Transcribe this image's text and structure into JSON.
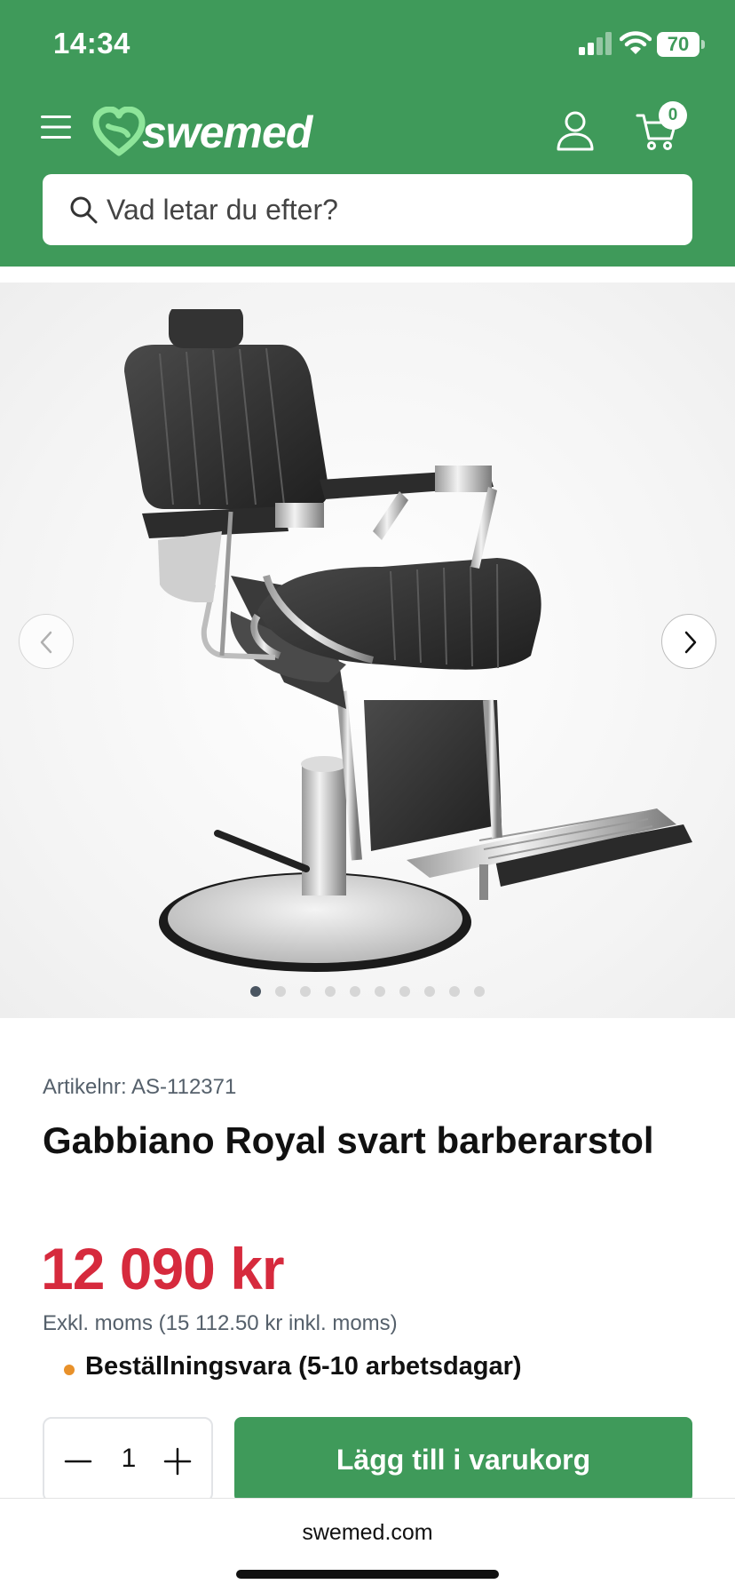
{
  "status_bar": {
    "time": "14:34",
    "battery": "70"
  },
  "header": {
    "brand": "swemed",
    "cart_count": "0",
    "colors": {
      "brand_green": "#3f9a5a",
      "logo_mark": "#8ee59a"
    }
  },
  "search": {
    "placeholder": "Vad letar du efter?",
    "icon": "search-icon"
  },
  "gallery": {
    "image_count": 10,
    "active_index": 0
  },
  "product": {
    "article_number": "Artikelnr: AS-112371",
    "title": "Gabbiano Royal svart barberarstol",
    "price": "12 090 kr",
    "price_note": "Exkl. moms (15 112.50 kr inkl. moms)",
    "availability": "Beställningsvara (5-10 arbetsdagar)",
    "price_color": "#d62a3d",
    "availability_color": "#e8912a"
  },
  "purchase": {
    "quantity": "1",
    "add_to_cart_label": "Lägg till i varukorg"
  },
  "browser": {
    "url": "swemed.com"
  }
}
